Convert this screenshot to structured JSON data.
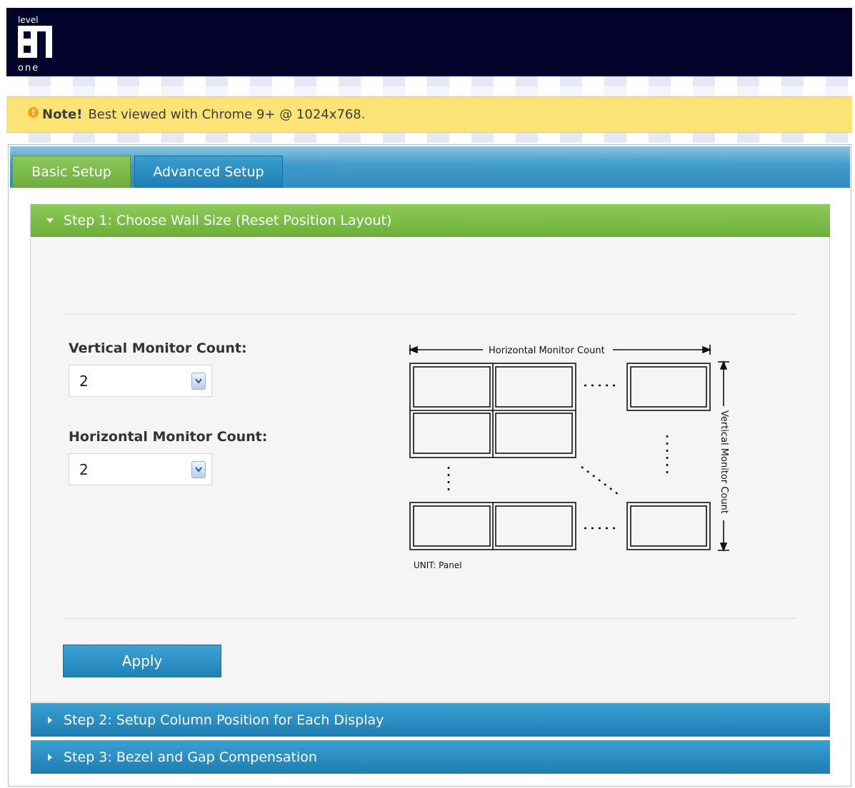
{
  "brand": {
    "logo_top_text": "level",
    "logo_bottom_text": "one"
  },
  "note": {
    "strong": "Note!",
    "text": "Best viewed with Chrome 9+ @ 1024x768."
  },
  "tabs": [
    {
      "label": "Basic Setup",
      "active": true
    },
    {
      "label": "Advanced Setup",
      "active": false
    }
  ],
  "steps": [
    {
      "label": "Step 1: Choose Wall Size (Reset Position Layout)",
      "expanded": true
    },
    {
      "label": "Step 2: Setup Column Position for Each Display",
      "expanded": false
    },
    {
      "label": "Step 3: Bezel and Gap Compensation",
      "expanded": false
    }
  ],
  "form": {
    "vertical_label": "Vertical Monitor Count:",
    "vertical_value": "2",
    "horizontal_label": "Horizontal Monitor Count:",
    "horizontal_value": "2"
  },
  "diagram": {
    "horizontal_label": "Horizontal Monitor Count",
    "vertical_label": "Vertical Monitor Count",
    "unit_label": "UNIT: Panel"
  },
  "apply_label": "Apply",
  "colors": {
    "header_bg": "#02022a",
    "note_bg": "#fbe376",
    "green_accent": "#6fae3e",
    "blue_accent": "#1f7fb4"
  }
}
